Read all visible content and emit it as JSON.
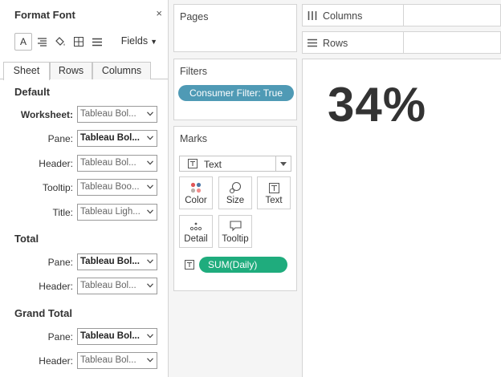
{
  "format_panel": {
    "title": "Format Font",
    "close_glyph": "×",
    "fields_label": "Fields",
    "tabs": [
      {
        "label": "Sheet",
        "active": true
      },
      {
        "label": "Rows",
        "active": false
      },
      {
        "label": "Columns",
        "active": false
      }
    ],
    "sections": {
      "default": {
        "title": "Default",
        "rows": [
          {
            "label": "Worksheet:",
            "value": "Tableau Bol..."
          },
          {
            "label": "Pane:",
            "value": "Tableau Bol..."
          },
          {
            "label": "Header:",
            "value": "Tableau Bol..."
          },
          {
            "label": "Tooltip:",
            "value": "Tableau Boo..."
          },
          {
            "label": "Title:",
            "value": "Tableau Ligh..."
          }
        ]
      },
      "total": {
        "title": "Total",
        "rows": [
          {
            "label": "Pane:",
            "value": "Tableau Bol..."
          },
          {
            "label": "Header:",
            "value": "Tableau Bol..."
          }
        ]
      },
      "grand_total": {
        "title": "Grand Total",
        "rows": [
          {
            "label": "Pane:",
            "value": "Tableau Bol..."
          },
          {
            "label": "Header:",
            "value": "Tableau Bol..."
          }
        ]
      }
    }
  },
  "pages": {
    "title": "Pages"
  },
  "filters": {
    "title": "Filters",
    "pill": "Consumer Filter: True",
    "pill_color": "#4f9ab5"
  },
  "marks": {
    "title": "Marks",
    "mark_type": "Text",
    "buttons": [
      {
        "label": "Color",
        "icon": "color-dots-icon"
      },
      {
        "label": "Size",
        "icon": "size-icon"
      },
      {
        "label": "Text",
        "icon": "text-icon"
      },
      {
        "label": "Detail",
        "icon": "detail-icon"
      },
      {
        "label": "Tooltip",
        "icon": "tooltip-icon"
      }
    ],
    "measure_pill": "SUM(Daily)",
    "measure_color": "#1fac7d"
  },
  "columns_shelf": {
    "label": "Columns"
  },
  "rows_shelf": {
    "label": "Rows"
  },
  "view": {
    "value": "34%"
  }
}
